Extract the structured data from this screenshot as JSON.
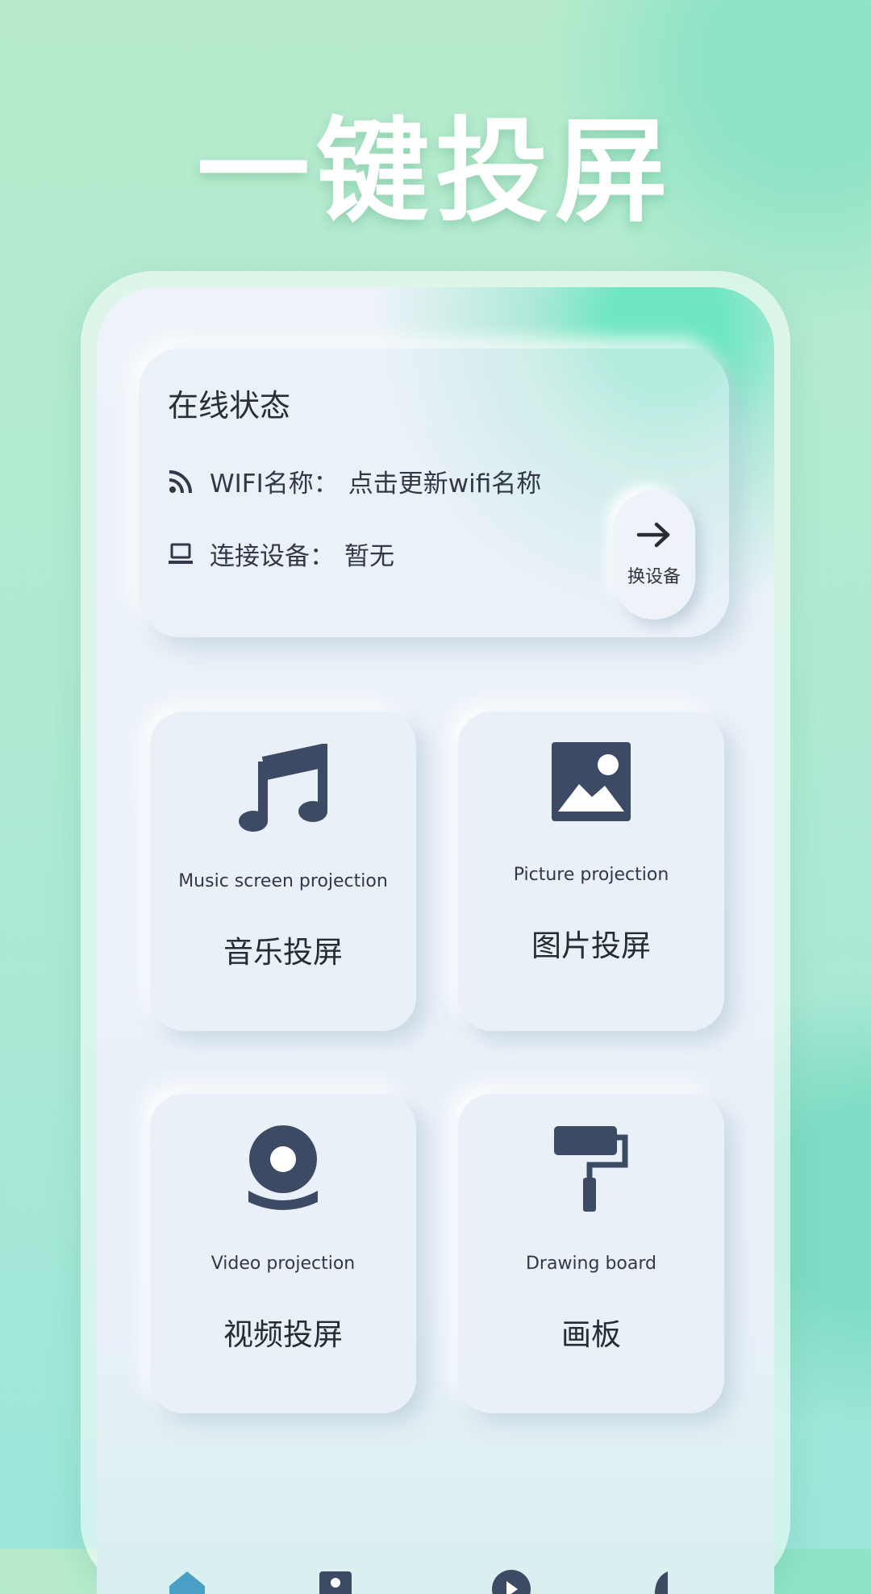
{
  "hero": {
    "title": "一键投屏"
  },
  "status": {
    "title": "在线状态",
    "wifi_label": "WIFI名称：",
    "wifi_value": "点击更新wifi名称",
    "device_label": "连接设备：",
    "device_value": "暂无",
    "switch_label": "换设备"
  },
  "tiles": [
    {
      "en": "Music screen projection",
      "cn": "音乐投屏",
      "icon": "music-note-icon"
    },
    {
      "en": "Picture projection",
      "cn": "图片投屏",
      "icon": "picture-icon"
    },
    {
      "en": "Video projection",
      "cn": "视频投屏",
      "icon": "webcam-icon"
    },
    {
      "en": "Drawing board",
      "cn": "画板",
      "icon": "paint-roller-icon"
    }
  ],
  "bottom_nav": [
    "home-icon",
    "contact-icon",
    "play-icon",
    "leaf-icon"
  ],
  "colors": {
    "accent": "#6fe6c1",
    "icon": "#3c4a63",
    "text": "#262b35"
  }
}
